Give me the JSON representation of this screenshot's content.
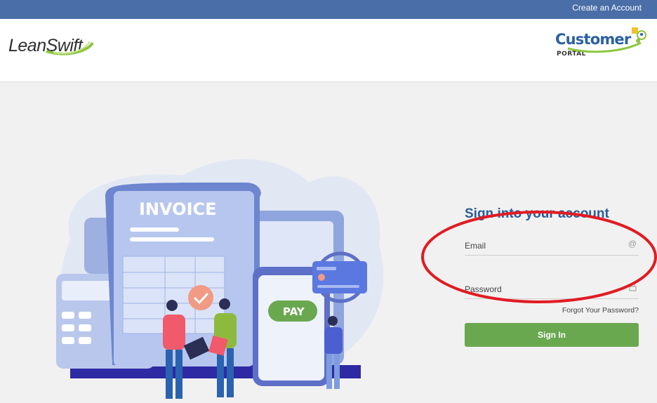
{
  "topbar": {
    "create_account": "Create an Account"
  },
  "header": {
    "left_logo": "LeanSwift",
    "right_logo_main": "Customer",
    "right_logo_sub": "PORTAL"
  },
  "illustration": {
    "invoice_label": "INVOICE",
    "pay_label": "PAY"
  },
  "signin": {
    "title": "Sign into your account",
    "email_label": "Email",
    "password_label": "Password",
    "forgot": "Forgot Your Password?",
    "button": "Sign In"
  },
  "colors": {
    "topbar": "#4a6ea7",
    "title": "#2b5a9a",
    "button": "#6aa84f",
    "annotation": "#e11b22"
  }
}
